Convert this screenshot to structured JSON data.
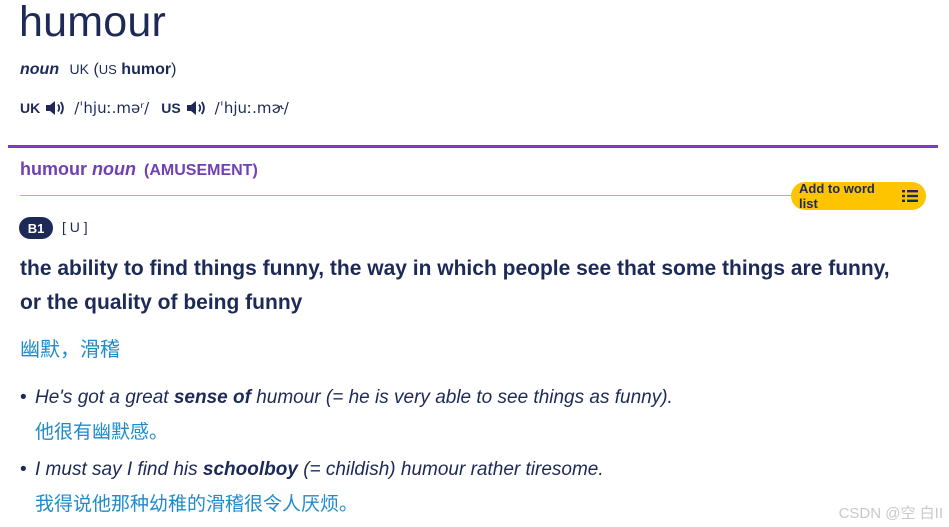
{
  "entry": {
    "headword": "humour",
    "pos": "noun",
    "label_uk": "UK",
    "paren_open": "(",
    "label_us": "US",
    "us_variant": "humor",
    "paren_close": ")"
  },
  "pronunciation": {
    "uk_label": "UK",
    "uk_ipa": "/ˈhjuː.məʳ/",
    "us_label": "US",
    "us_ipa": "/ˈhjuː.mɚ/",
    "speaker_icon": "speaker-icon"
  },
  "sense": {
    "word": "humour",
    "pos": "noun",
    "guideword": "(AMUSEMENT)",
    "add_to_word_list": "Add to word list",
    "list_icon": "list-icon",
    "level": "B1",
    "grammar": "[ U ]",
    "definition": "the ability to find things funny, the way in which people see that some things are funny, or the quality of being funny",
    "translation": "幽默，滑稽"
  },
  "examples": [
    {
      "part1": "He's got a great ",
      "bold": "sense of",
      "part2": " humour (= he is very able to see things as funny).",
      "translation": "他很有幽默感。"
    },
    {
      "part1": "I must say I find his ",
      "bold": "schoolboy",
      "part2": " (= childish) humour rather tiresome.",
      "translation": "我得说他那种幼稚的滑稽很令人厌烦。"
    }
  ],
  "watermark": "CSDN @空 白II",
  "colors": {
    "navy": "#1d2a57",
    "purple": "#7040b5",
    "yellow": "#fec400",
    "translation_blue": "#1e8bcb"
  }
}
